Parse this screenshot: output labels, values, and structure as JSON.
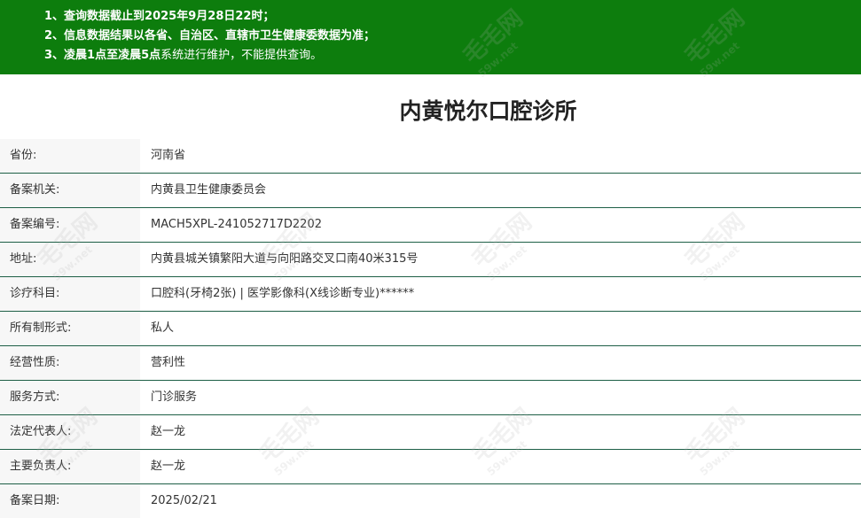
{
  "notice": {
    "line1_prefix": "1、",
    "line1_text": "查询数据截止到2025年9月28日22时；",
    "line2_prefix": "2、",
    "line2_text": "信息数据结果以各省、自治区、直辖市卫生健康委数据为准；",
    "line3_prefix": "3、",
    "line3_bold": "凌晨1点至凌晨5点",
    "line3_rest": "系统进行维护，不能提供查询。"
  },
  "title": "内黄悦尔口腔诊所",
  "rows": [
    {
      "label": "省份:",
      "value": "河南省"
    },
    {
      "label": "备案机关:",
      "value": "内黄县卫生健康委员会"
    },
    {
      "label": "备案编号:",
      "value": "MACH5XPL-241052717D2202"
    },
    {
      "label": "地址:",
      "value": "内黄县城关镇繁阳大道与向阳路交叉口南40米315号"
    },
    {
      "label": "诊疗科目:",
      "value": "口腔科(牙椅2张) | 医学影像科(X线诊断专业)******"
    },
    {
      "label": "所有制形式:",
      "value": "私人"
    },
    {
      "label": "经营性质:",
      "value": "营利性"
    },
    {
      "label": "服务方式:",
      "value": "门诊服务"
    },
    {
      "label": "法定代表人:",
      "value": "赵一龙"
    },
    {
      "label": "主要负责人:",
      "value": "赵一龙"
    },
    {
      "label": "备案日期:",
      "value": "2025/02/21"
    }
  ],
  "watermark": {
    "text": "毛毛网",
    "sub": "59w.net"
  },
  "colors": {
    "notice_bg": "#0d7d0d",
    "row_border": "#1e5f46",
    "label_bg": "#f7f7f7"
  }
}
